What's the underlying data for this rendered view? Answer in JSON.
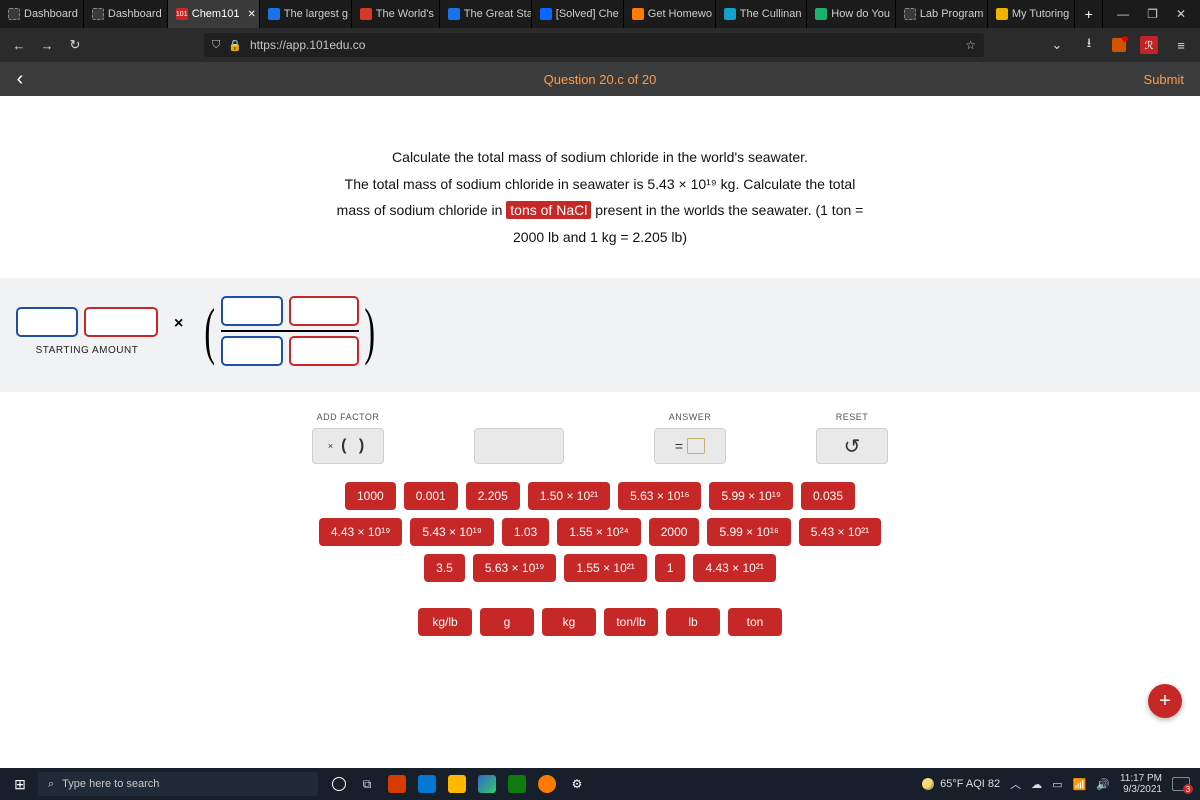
{
  "browser": {
    "tabs": [
      {
        "label": "Dashboard",
        "fav": "#3a3a3a"
      },
      {
        "label": "Dashboard",
        "fav": "#3a3a3a"
      },
      {
        "label": "Chem101",
        "fav": "#c62828",
        "active": true,
        "prefix": "101"
      },
      {
        "label": "The largest g",
        "fav": "#1a73e8"
      },
      {
        "label": "The World's",
        "fav": "#d33a2c"
      },
      {
        "label": "The Great Sta",
        "fav": "#1a73e8"
      },
      {
        "label": "[Solved] Che",
        "fav": "#0b66ff"
      },
      {
        "label": "Get Homewo",
        "fav": "#ff7a00"
      },
      {
        "label": "The Cullinan",
        "fav": "#14a0c9"
      },
      {
        "label": "How do You",
        "fav": "#18b36b"
      },
      {
        "label": "Lab Program",
        "fav": "#3a3a3a"
      },
      {
        "label": "My Tutoring",
        "fav": "#f0b400"
      }
    ],
    "url": "https://app.101edu.co",
    "win": {
      "min": "—",
      "max": "❐",
      "close": "✕"
    }
  },
  "app": {
    "title": "Question 20.c of 20",
    "submit": "Submit"
  },
  "question": {
    "line1": "Calculate the total mass of sodium chloride in the world's seawater.",
    "line2a": "The total mass of sodium chloride in seawater is 5.43 × 10¹⁹ kg. Calculate the total",
    "line2b": "mass of sodium chloride in ",
    "chip": "tons of NaCl",
    "line2c": " present in the worlds the seawater. (1 ton =",
    "line3": "2000 lb and 1 kg = 2.205 lb)"
  },
  "starting_label": "STARTING AMOUNT",
  "tools": {
    "addfactor": {
      "label": "ADD FACTOR",
      "display": "(  )",
      "x": "×"
    },
    "answer": {
      "label": "ANSWER",
      "eq": "="
    },
    "reset": {
      "label": "RESET",
      "glyph": "↺"
    }
  },
  "numchips": {
    "r1": [
      "1000",
      "0.001",
      "2.205",
      "1.50 × 10²¹",
      "5.63 × 10¹⁶",
      "5.99 × 10¹⁹",
      "0.035"
    ],
    "r2": [
      "4.43 × 10¹⁹",
      "5.43 × 10¹⁹",
      "1.03",
      "1.55 × 10²⁴",
      "2000",
      "5.99 × 10¹⁶",
      "5.43 × 10²¹"
    ],
    "r3": [
      "3.5",
      "5.63 × 10¹⁹",
      "1.55 × 10²¹",
      "1",
      "4.43 × 10²¹"
    ]
  },
  "unitchips": [
    "kg/lb",
    "g",
    "kg",
    "ton/lb",
    "lb",
    "ton"
  ],
  "fab": "+",
  "taskbar": {
    "search_placeholder": "Type here to search",
    "weather": "65°F  AQI 82",
    "time": "11:17 PM",
    "date": "9/3/2021"
  }
}
